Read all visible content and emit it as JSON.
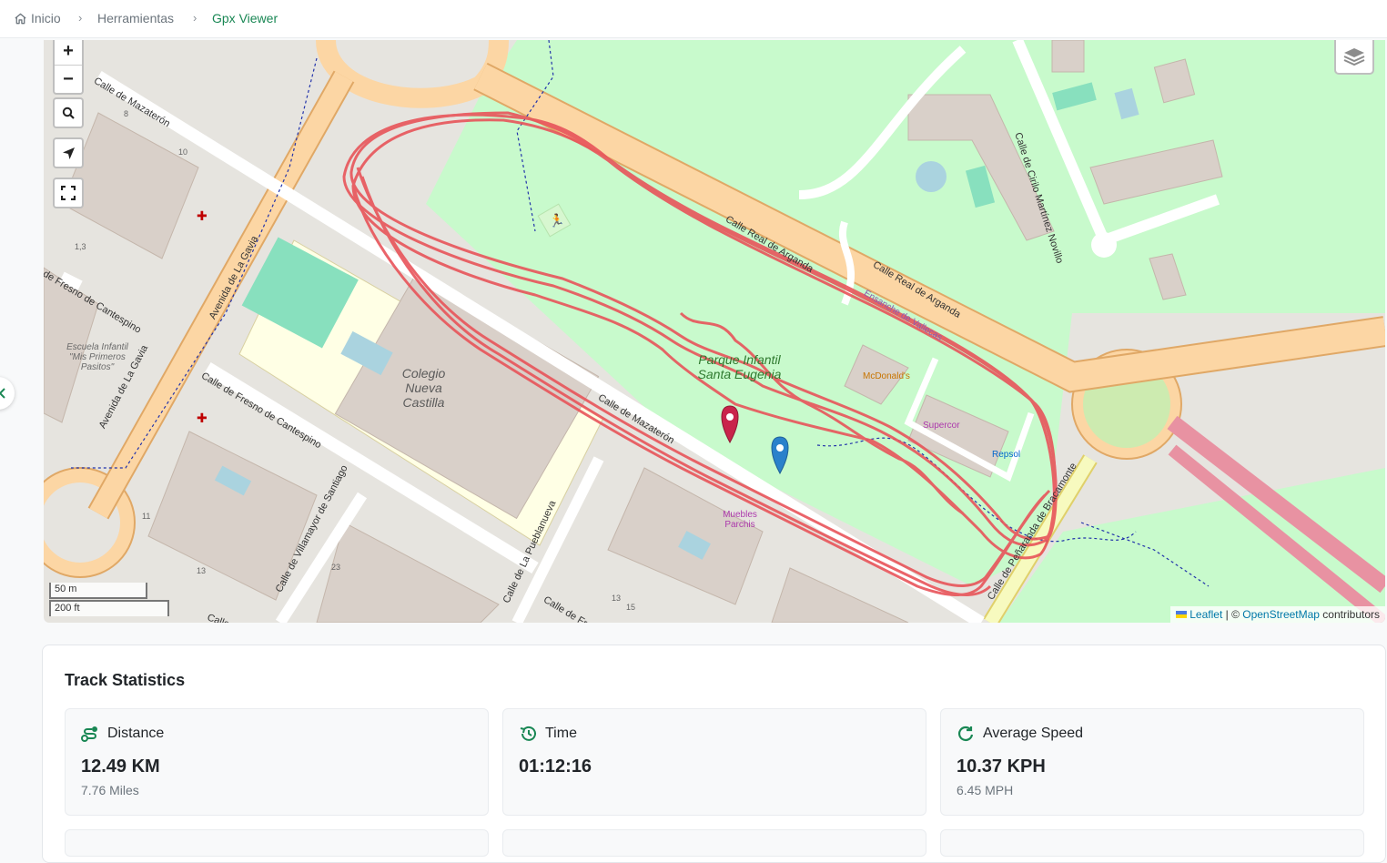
{
  "breadcrumb": [
    {
      "label": "Inicio",
      "icon": "home-icon"
    },
    {
      "label": "Herramientas"
    },
    {
      "label": "Gpx Viewer",
      "active": true
    }
  ],
  "map": {
    "controls": {
      "zoom_in": "+",
      "zoom_out": "−"
    },
    "streets": {
      "mazateron_top": "Calle de Mazaterón",
      "mazateron_mid": "Calle de Mazaterón",
      "gavia_top": "Avenida de La Gavia",
      "gavia_bottom": "Avenida de La Gavia",
      "fresno_left": "de Fresno de Cantespino",
      "fresno_mid": "Calle de Fresno de Cantespino",
      "real_arganda_1": "Calle Real de Arganda",
      "real_arganda_2": "Calle Real de Arganda",
      "ensanche": "Ensanche de Vallecas",
      "cirilo": "Calle de Cirilo Martínez Novillo",
      "villamayor": "Calle de Villamayor de Santiago",
      "puebla": "Calle de La Pueblanueva",
      "penaranda": "Calle de Peñaranda de Bracamonte",
      "fresno_bottom": "Calle de Fresn",
      "calle_bottom": "Calle"
    },
    "pois": {
      "escuela": "Escuela Infantil \"Mis Primeros Pasitos\"",
      "colegio": "Colegio Nueva Castilla",
      "parque": "Parque Infantil Santa Eugenia",
      "mcdonalds": "McDonald's",
      "supercor": "Supercor",
      "repsol": "Repsol",
      "muebles": "Muebles Parchis"
    },
    "house_numbers": [
      "8",
      "10",
      "1,3",
      "11",
      "13",
      "23",
      "13",
      "15"
    ],
    "scale": {
      "metric": "50 m",
      "imperial": "200 ft"
    },
    "attribution": {
      "leaflet": "Leaflet",
      "separator": " | © ",
      "osm": "OpenStreetMap",
      "suffix": " contributors"
    },
    "colors": {
      "track": "#e8545a",
      "park": "#c8facc",
      "road_major": "#fcd6a4",
      "start_marker": "#c9244b",
      "end_marker": "#2a81cb"
    }
  },
  "stats": {
    "title": "Track Statistics",
    "items": [
      {
        "label": "Distance",
        "icon": "route-icon",
        "value": "12.49 KM",
        "sub": "7.76 Miles"
      },
      {
        "label": "Time",
        "icon": "history-icon",
        "value": "01:12:16",
        "sub": ""
      },
      {
        "label": "Average Speed",
        "icon": "refresh-icon",
        "value": "10.37 KPH",
        "sub": "6.45 MPH"
      }
    ]
  },
  "theme": {
    "accent": "#198754"
  }
}
